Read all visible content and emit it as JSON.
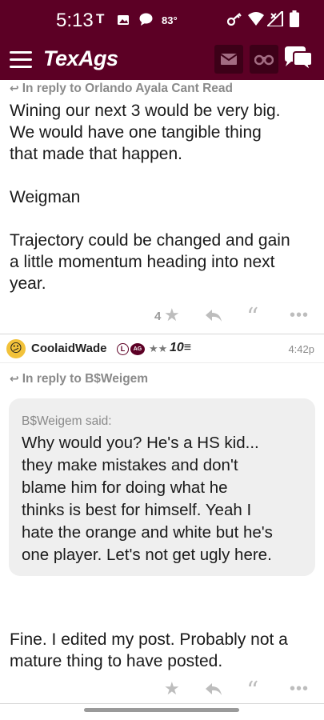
{
  "status_bar": {
    "time": "5:13",
    "temperature": "83°",
    "icons": [
      "t-mobile-icon",
      "image-icon",
      "chat-bubble-icon",
      "key-icon",
      "wifi-icon",
      "signal-icon",
      "battery-icon"
    ]
  },
  "nav": {
    "brand": "TexAgs",
    "icons": [
      "menu-icon",
      "mail-icon",
      "binoculars-icon",
      "chat-bubbles-icon"
    ]
  },
  "colors": {
    "header_bg": "#5c0025",
    "header_btn_bg": "#3d0018",
    "quote_bg": "#efefef"
  },
  "post1": {
    "reply_to": "In reply to Orlando Ayala Cant Read",
    "lines": [
      "Wining our next 3 would be very big.",
      "We would have one tangible thing",
      "that made that happen.",
      "",
      "Weigman",
      "",
      "Trajectory could be changed and gain",
      "a little momentum heading into next",
      "year."
    ],
    "star_count": "4"
  },
  "post2": {
    "author": "CoolaidWade",
    "badge_l": "L",
    "badge_ag": "AG",
    "stars": "★★",
    "rank": "10≡",
    "time": "4:42p",
    "reply_to": "In reply to B$Weigem",
    "quote_header": "B$Weigem said:",
    "quote_lines": [
      "Why would you? He's a HS kid...",
      "they make mistakes and don't",
      "blame him for doing what he",
      "thinks is best for himself. Yeah I",
      "hate the orange and white but he's",
      "one player. Let's not get ugly here."
    ],
    "lines": [
      "Fine. I edited my post. Probably not a",
      "mature thing to have posted."
    ]
  }
}
